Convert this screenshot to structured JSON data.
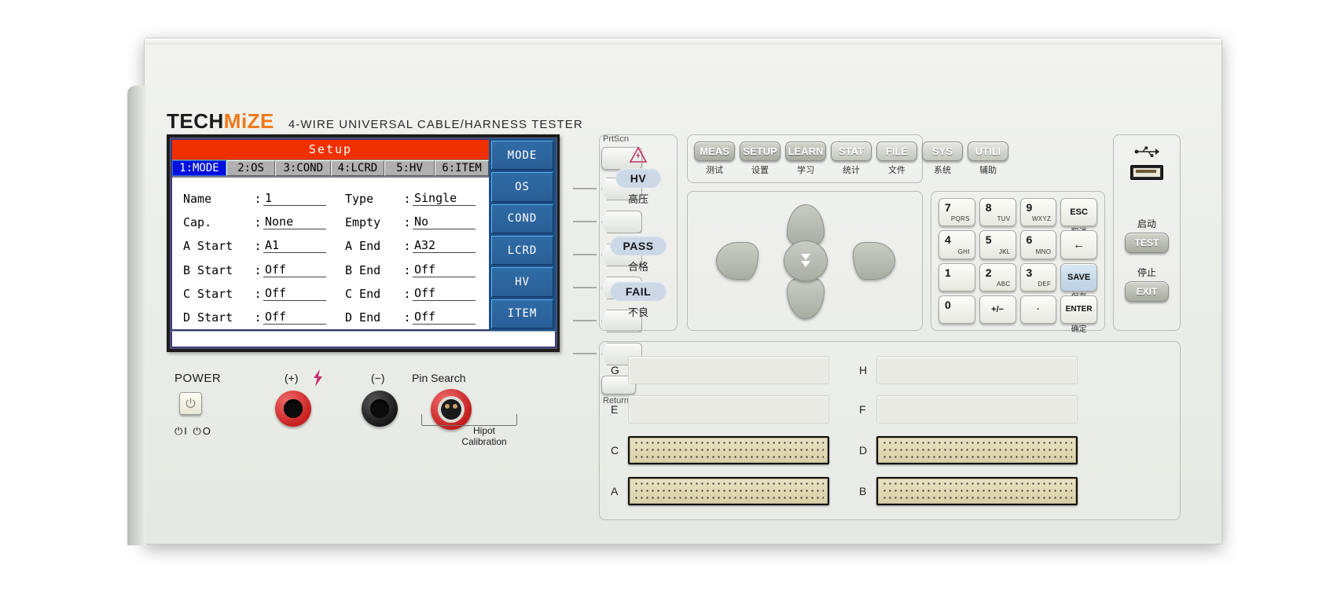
{
  "brand": {
    "name_part1": "TECH",
    "name_part2": "MiZE",
    "subtitle": "4-WIRE  UNIVERSAL  CABLE/HARNESS  TESTER"
  },
  "lcd": {
    "title": "Setup",
    "tabs": [
      {
        "label": "1:MODE",
        "selected": true
      },
      {
        "label": "2:OS",
        "selected": false
      },
      {
        "label": "3:COND",
        "selected": false
      },
      {
        "label": "4:LCRD",
        "selected": false
      },
      {
        "label": "5:HV",
        "selected": false
      },
      {
        "label": "6:ITEM",
        "selected": false
      }
    ],
    "fields": [
      {
        "left_label": "Name",
        "left_value": "1",
        "right_label": "Type",
        "right_value": "Single"
      },
      {
        "left_label": "Cap.",
        "left_value": "None",
        "right_label": "Empty",
        "right_value": "No"
      },
      {
        "left_label": "A Start",
        "left_value": "A1",
        "right_label": "A End",
        "right_value": "A32"
      },
      {
        "left_label": "B Start",
        "left_value": "Off",
        "right_label": "B End",
        "right_value": "Off"
      },
      {
        "left_label": "C Start",
        "left_value": "Off",
        "right_label": "C End",
        "right_value": "Off"
      },
      {
        "left_label": "D Start",
        "left_value": "Off",
        "right_label": "D End",
        "right_value": "Off"
      }
    ],
    "status_text": "",
    "colon": ":",
    "softkeys": [
      "MODE",
      "OS",
      "COND",
      "LCRD",
      "HV",
      "ITEM"
    ]
  },
  "sidekeys": {
    "top_label": "PrtScn",
    "bottom_label": "Return"
  },
  "status_panel": {
    "hv_warning_icon": "high-voltage-warning-icon",
    "lamps": [
      {
        "en": "HV",
        "cn": "高压"
      },
      {
        "en": "PASS",
        "cn": "合格"
      },
      {
        "en": "FAIL",
        "cn": "不良"
      }
    ]
  },
  "function_keys": [
    {
      "en": "MEAS",
      "cn": "测试"
    },
    {
      "en": "SETUP",
      "cn": "设置"
    },
    {
      "en": "LEARN",
      "cn": "学习"
    },
    {
      "en": "STAT",
      "cn": "统计"
    },
    {
      "en": "FILE",
      "cn": "文件"
    },
    {
      "en": "SYS",
      "cn": "系统"
    },
    {
      "en": "UTILI",
      "cn": "辅助"
    }
  ],
  "dpad": {
    "up": "arrow-up-icon",
    "down": "arrow-down-icon",
    "left": "arrow-left-icon",
    "right": "arrow-right-icon",
    "center": "double-arrow-down-icon"
  },
  "keypad": [
    {
      "big": "7",
      "sml": "PQRS",
      "ctr": "",
      "cn": "",
      "kind": "num",
      "name": "key-7"
    },
    {
      "big": "8",
      "sml": "TUV",
      "ctr": "",
      "cn": "",
      "kind": "num",
      "name": "key-8"
    },
    {
      "big": "9",
      "sml": "WXYZ",
      "ctr": "",
      "cn": "",
      "kind": "num",
      "name": "key-9"
    },
    {
      "big": "",
      "sml": "",
      "ctr": "ESC",
      "cn": "取消",
      "kind": "fn",
      "name": "key-esc"
    },
    {
      "big": "4",
      "sml": "GHI",
      "ctr": "",
      "cn": "",
      "kind": "num",
      "name": "key-4"
    },
    {
      "big": "5",
      "sml": "JKL",
      "ctr": "",
      "cn": "",
      "kind": "num",
      "name": "key-5"
    },
    {
      "big": "6",
      "sml": "MNO",
      "ctr": "",
      "cn": "",
      "kind": "num",
      "name": "key-6"
    },
    {
      "big": "",
      "sml": "",
      "ctr": "←",
      "cn": "",
      "kind": "arrow",
      "name": "key-backspace"
    },
    {
      "big": "1",
      "sml": "",
      "ctr": "",
      "cn": "",
      "kind": "num",
      "name": "key-1"
    },
    {
      "big": "2",
      "sml": "ABC",
      "ctr": "",
      "cn": "",
      "kind": "num",
      "name": "key-2"
    },
    {
      "big": "3",
      "sml": "DEF",
      "ctr": "",
      "cn": "",
      "kind": "num",
      "name": "key-3"
    },
    {
      "big": "",
      "sml": "",
      "ctr": "SAVE",
      "cn": "保存",
      "kind": "save",
      "name": "key-save"
    },
    {
      "big": "0",
      "sml": "",
      "ctr": "",
      "cn": "",
      "kind": "num",
      "name": "key-0"
    },
    {
      "big": "",
      "sml": "",
      "ctr": "+/−",
      "cn": "",
      "kind": "fn",
      "name": "key-plusminus"
    },
    {
      "big": "",
      "sml": "",
      "ctr": "·",
      "cn": "",
      "kind": "fn",
      "name": "key-dot"
    },
    {
      "big": "",
      "sml": "",
      "ctr": "ENTER",
      "cn": "确定",
      "kind": "fn",
      "name": "key-enter"
    }
  ],
  "right_panel": {
    "usb_icon": "usb-icon",
    "test_cn": "启动",
    "test_en": "TEST",
    "exit_cn": "停止",
    "exit_en": "EXIT"
  },
  "connectors": [
    {
      "label": "G",
      "type": "blank",
      "side": "left",
      "row": 0
    },
    {
      "label": "H",
      "type": "blank",
      "side": "right",
      "row": 0
    },
    {
      "label": "E",
      "type": "blank",
      "side": "left",
      "row": 1
    },
    {
      "label": "F",
      "type": "blank",
      "side": "right",
      "row": 1
    },
    {
      "label": "C",
      "type": "pins",
      "side": "left",
      "row": 2
    },
    {
      "label": "D",
      "type": "pins",
      "side": "right",
      "row": 2
    },
    {
      "label": "A",
      "type": "pins",
      "side": "left",
      "row": 3
    },
    {
      "label": "B",
      "type": "pins",
      "side": "right",
      "row": 3
    }
  ],
  "bottom_left": {
    "power_label": "POWER",
    "power_icon": "power-symbol-icon",
    "power_mark": "⏻I ⏻O",
    "plus_label": "(+)",
    "minus_label": "(−)",
    "bolt_icon": "lightning-bolt-icon",
    "pin_search_label": "Pin Search",
    "hipot_line1": "Hipot",
    "hipot_line2": "Calibration"
  },
  "colors": {
    "brand_orange": "#f07818",
    "title_red": "#f03000",
    "tab_selected_blue": "#0010e0",
    "softkey_blue": "#2f6ba6",
    "lamp_blue": "#ccd8e6",
    "jack_red": "#c82020",
    "jack_black": "#181818",
    "chassis": "#eceee9"
  }
}
